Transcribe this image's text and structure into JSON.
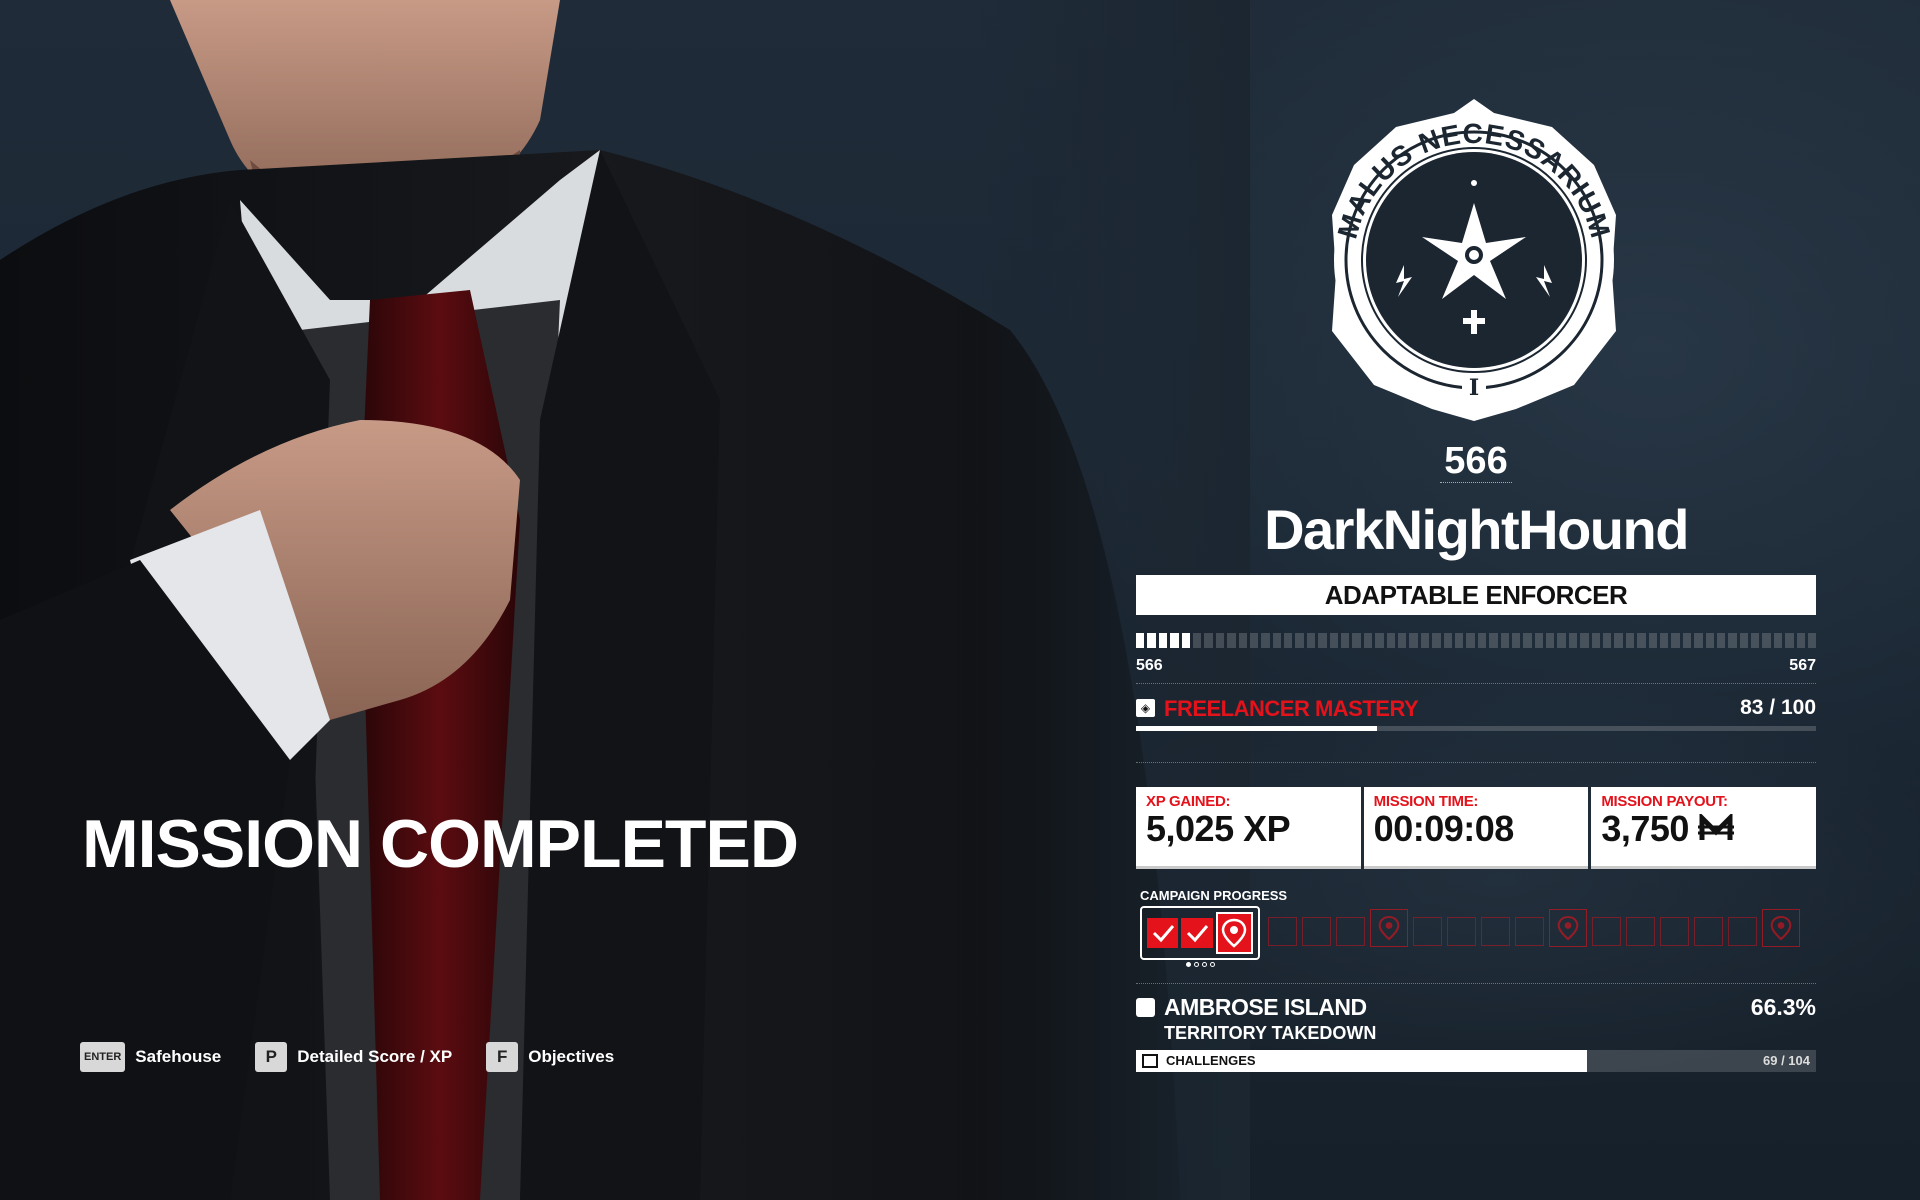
{
  "screen": {
    "title": "MISSION COMPLETED"
  },
  "prompts": [
    {
      "key": "ENTER",
      "label": "Safehouse"
    },
    {
      "key": "P",
      "label": "Detailed Score / XP"
    },
    {
      "key": "F",
      "label": "Objectives"
    }
  ],
  "profile": {
    "emblem_text": "MALUS NECESSARIUM",
    "emblem_numeral": "I",
    "level": "566",
    "username": "DarkNightHound",
    "rank_title": "ADAPTABLE ENFORCER",
    "level_from": "566",
    "level_to": "567",
    "level_progress": 0.09
  },
  "mastery": {
    "label": "FREELANCER MASTERY",
    "value": "83 / 100",
    "progress": 0.355
  },
  "stats": [
    {
      "label": "XP GAINED:",
      "value": "5,025 XP"
    },
    {
      "label": "MISSION TIME:",
      "value": "00:09:08"
    },
    {
      "label": "MISSION PAYOUT:",
      "value": "3,750",
      "currency": "merces-icon"
    }
  ],
  "campaign": {
    "label": "CAMPAIGN PROGRESS",
    "completed": 2,
    "current_slot": "target-icon",
    "page_dots": 4,
    "active_dot": 1
  },
  "territory": {
    "name": "AMBROSE ISLAND",
    "mode": "TERRITORY TAKEDOWN",
    "percent": "66.3%",
    "challenges_label": "CHALLENGES",
    "challenges_value": "69 / 104",
    "challenges_progress": 0.663
  },
  "colors": {
    "accent_red": "#e3121b",
    "panel_white": "#ffffff",
    "background": "#1b2631"
  }
}
